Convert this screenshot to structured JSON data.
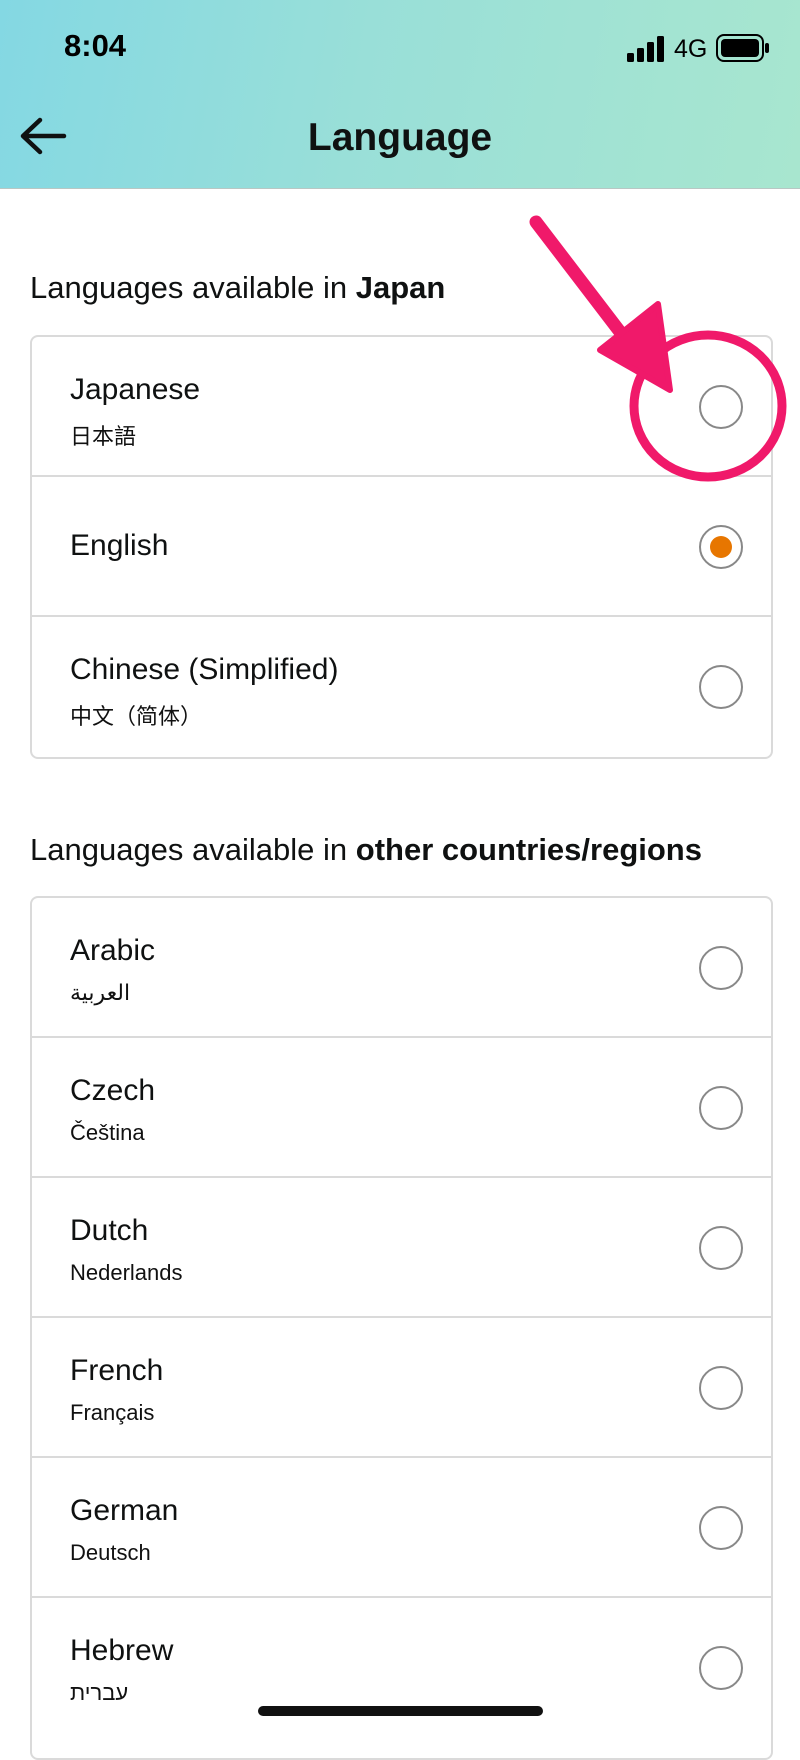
{
  "status_bar": {
    "time": "8:04",
    "network": "4G"
  },
  "header": {
    "title": "Language"
  },
  "sections": [
    {
      "heading_prefix": "Languages available in ",
      "heading_bold": "Japan",
      "items": [
        {
          "name": "Japanese",
          "native": "日本語",
          "selected": false
        },
        {
          "name": "English",
          "native": "",
          "selected": true
        },
        {
          "name": "Chinese (Simplified)",
          "native": "中文（简体）",
          "selected": false
        }
      ]
    },
    {
      "heading_prefix": "Languages available in ",
      "heading_bold": "other countries/regions",
      "items": [
        {
          "name": "Arabic",
          "native": "العربية",
          "selected": false
        },
        {
          "name": "Czech",
          "native": "Čeština",
          "selected": false
        },
        {
          "name": "Dutch",
          "native": "Nederlands",
          "selected": false
        },
        {
          "name": "French",
          "native": "Français",
          "selected": false
        },
        {
          "name": "German",
          "native": "Deutsch",
          "selected": false
        },
        {
          "name": "Hebrew",
          "native": "עברית",
          "selected": false
        }
      ]
    }
  ],
  "colors": {
    "accent": "#e77600",
    "annotation": "#f0196a"
  }
}
